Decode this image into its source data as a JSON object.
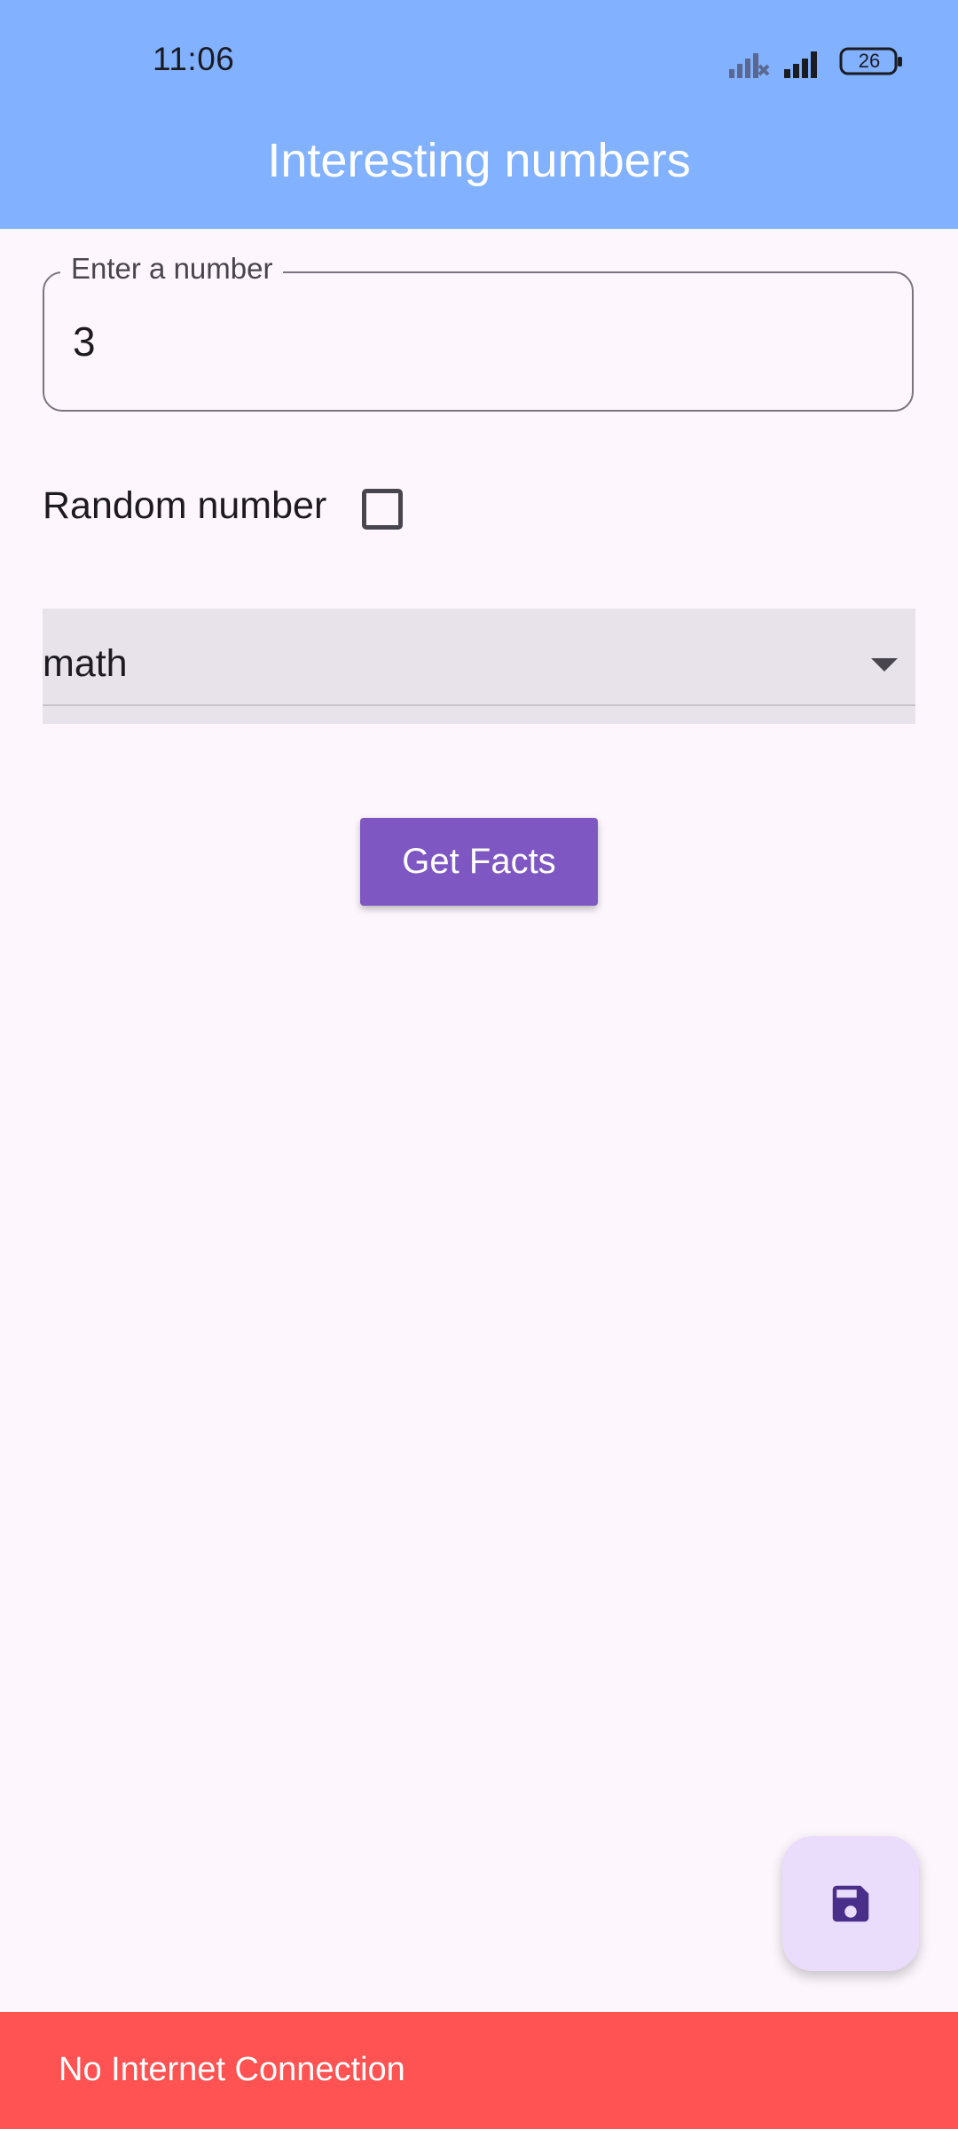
{
  "status_bar": {
    "time": "11:06",
    "battery": "26",
    "icons": [
      "signal-off-icon",
      "signal-icon",
      "battery-icon"
    ]
  },
  "appbar": {
    "title": "Interesting numbers",
    "color": "#82b1ff"
  },
  "number_field": {
    "label": "Enter a number",
    "value": "3"
  },
  "random_option": {
    "label": "Random number",
    "checked": false
  },
  "type_dropdown": {
    "selected": "math",
    "icon": "dropdown-arrow-icon"
  },
  "actions": {
    "get_facts_label": "Get Facts",
    "button_color": "#7e57c2",
    "fab_icon": "save-icon"
  },
  "snackbar": {
    "message": "No Internet Connection",
    "color": "#ff5252"
  }
}
